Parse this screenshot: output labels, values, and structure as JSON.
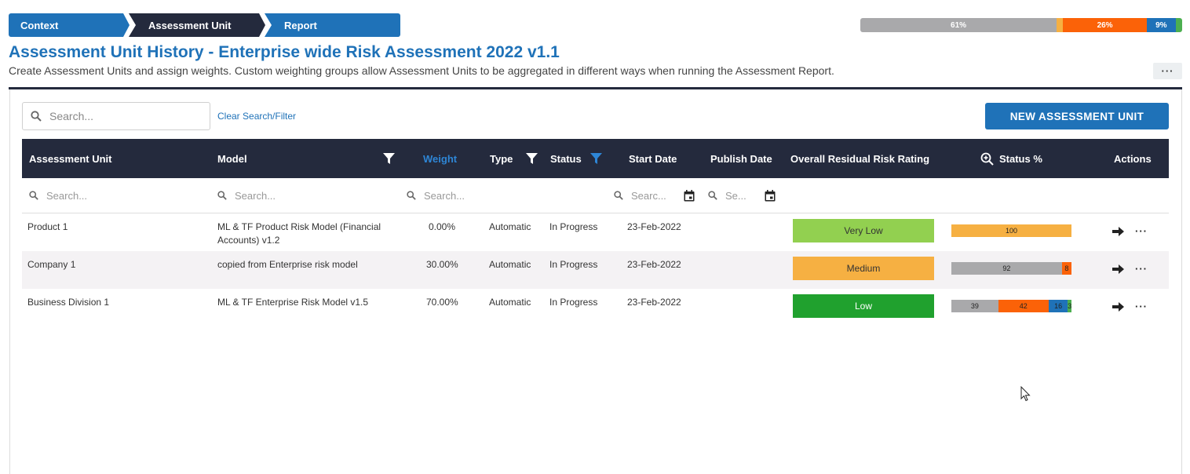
{
  "breadcrumb": {
    "steps": [
      "Context",
      "Assessment Unit",
      "Report"
    ]
  },
  "top_progress": {
    "segments": [
      {
        "label": "61%",
        "value": 61,
        "color": "#a9a9ab"
      },
      {
        "label": "",
        "value": 2,
        "color": "#f6b042"
      },
      {
        "label": "26%",
        "value": 26,
        "color": "#fb6208"
      },
      {
        "label": "9%",
        "value": 9,
        "color": "#1f72b8"
      },
      {
        "label": "",
        "value": 2,
        "color": "#4caf50"
      }
    ]
  },
  "page": {
    "title": "Assessment Unit History - Enterprise wide Risk Assessment 2022 v1.1",
    "subtitle": "Create Assessment Units and assign weights. Custom weighting groups allow Assessment Units to be aggregated in different ways when running the Assessment Report.",
    "more_label": "···"
  },
  "toolbar": {
    "search_placeholder": "Search...",
    "clear_label": "Clear Search/Filter",
    "new_button": "NEW ASSESSMENT UNIT"
  },
  "table": {
    "headers": {
      "unit": "Assessment Unit",
      "model": "Model",
      "weight": "Weight",
      "type": "Type",
      "status": "Status",
      "start": "Start Date",
      "publish": "Publish Date",
      "rating": "Overall Residual Risk Rating",
      "status_pct": "Status %",
      "actions": "Actions"
    },
    "filters": {
      "unit": "Search...",
      "model": "Search...",
      "weight": "Search...",
      "start": "Searc...",
      "publish": "Se..."
    },
    "rows": [
      {
        "unit": "Product 1",
        "model_line1": "ML & TF Product Risk Model (Financial",
        "model_line2": "Accounts) v1.2",
        "weight": "0.00%",
        "type": "Automatic",
        "status": "In Progress",
        "start": "23-Feb-2022",
        "publish": "",
        "rating": "Very Low",
        "rating_color": "#92d050",
        "rating_text_color": "#333333",
        "status_bar": [
          {
            "label": "100",
            "value": 100,
            "color": "#f6b042"
          }
        ]
      },
      {
        "unit": "Company 1",
        "model_line1": "copied from Enterprise risk model",
        "model_line2": "",
        "weight": "30.00%",
        "type": "Automatic",
        "status": "In Progress",
        "start": "23-Feb-2022",
        "publish": "",
        "rating": "Medium",
        "rating_color": "#f6b042",
        "rating_text_color": "#333333",
        "status_bar": [
          {
            "label": "92",
            "value": 92,
            "color": "#a9a9ab"
          },
          {
            "label": "8",
            "value": 8,
            "color": "#fb6208"
          }
        ]
      },
      {
        "unit": "Business Division 1",
        "model_line1": "ML & TF Enterprise Risk Model v1.5",
        "model_line2": "",
        "weight": "70.00%",
        "type": "Automatic",
        "status": "In Progress",
        "start": "23-Feb-2022",
        "publish": "",
        "rating": "Low",
        "rating_color": "#20a12e",
        "rating_text_color": "#ffffff",
        "status_bar": [
          {
            "label": "39",
            "value": 39,
            "color": "#a9a9ab"
          },
          {
            "label": "42",
            "value": 42,
            "color": "#fb6208"
          },
          {
            "label": "16",
            "value": 16,
            "color": "#1f72b8"
          },
          {
            "label": "3",
            "value": 3,
            "color": "#4caf50"
          }
        ]
      }
    ]
  },
  "icons": {
    "search": "search-icon",
    "filter": "filter-icon",
    "calendar": "calendar-icon",
    "zoom": "zoom-in-icon",
    "arrow": "arrow-right-icon",
    "more": "more-icon"
  }
}
